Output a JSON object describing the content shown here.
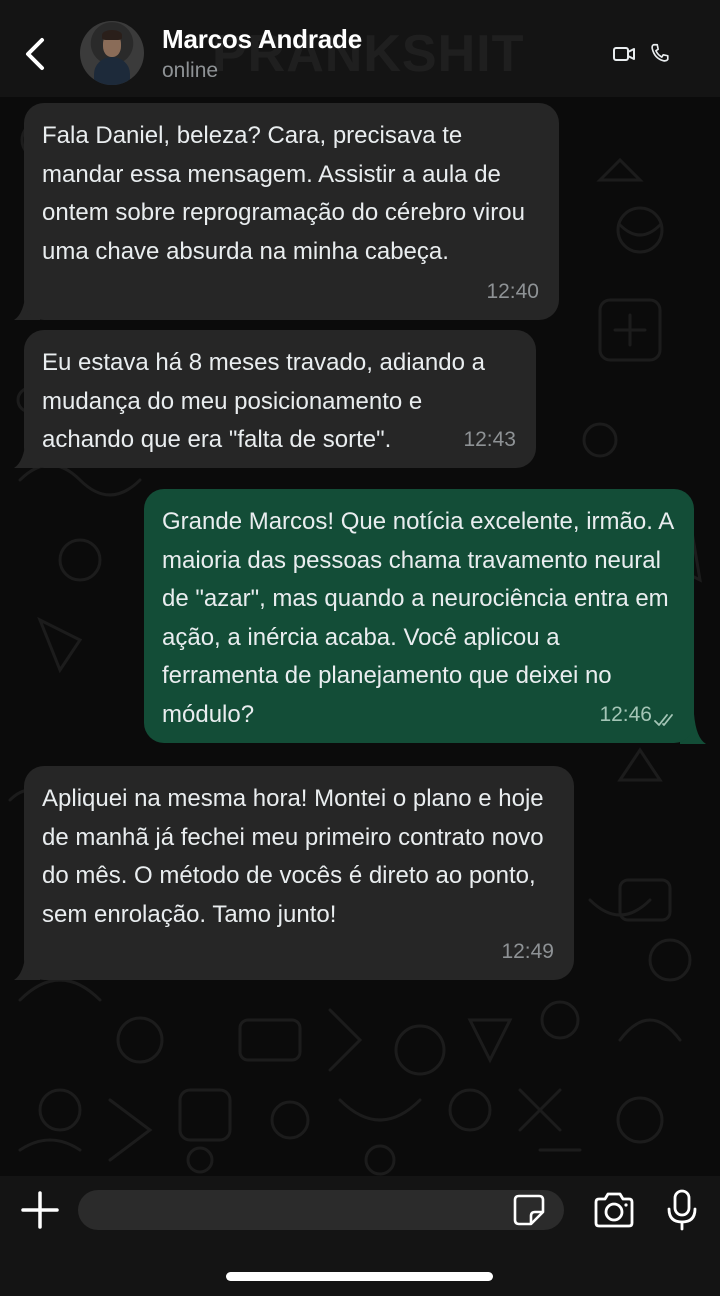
{
  "header": {
    "contact_name": "Marcos Andrade",
    "status": "online"
  },
  "watermark": "PRANKSHIT",
  "messages": [
    {
      "direction": "incoming",
      "text": "Fala Daniel, beleza? Cara, precisava te mandar essa mensagem. Assistir a aula de ontem sobre reprogramação do cérebro virou uma chave absurda na minha cabeça.",
      "time": "12:40"
    },
    {
      "direction": "incoming",
      "text": "Eu estava há 8 meses travado, adiando a mudança do meu posicionamento e achando que era \"falta de sorte\".",
      "time": "12:43"
    },
    {
      "direction": "outgoing",
      "text": "Grande Marcos! Que notícia excelente, irmão. A maioria das pessoas chama travamento neural de \"azar\", mas quando a neurociência entra em ação, a inércia acaba. Você aplicou a ferramenta de planejamento que deixei no módulo?",
      "time": "12:46",
      "status": "read"
    },
    {
      "direction": "incoming",
      "text": "Apliquei na mesma hora! Montei o plano e hoje de manhã já fechei meu primeiro contrato novo do mês. O método de vocês é direto ao ponto, sem enrolação. Tamo junto!",
      "time": "12:49"
    }
  ],
  "composer": {
    "value": "",
    "placeholder": ""
  },
  "colors": {
    "incoming_bubble": "#262626",
    "outgoing_bubble": "#134d37",
    "background": "#0b0b0b",
    "header": "#141414"
  },
  "icons": [
    "back-arrow-icon",
    "video-call-icon",
    "phone-icon",
    "plus-icon",
    "sticker-icon",
    "camera-icon",
    "microphone-icon",
    "double-check-icon"
  ]
}
